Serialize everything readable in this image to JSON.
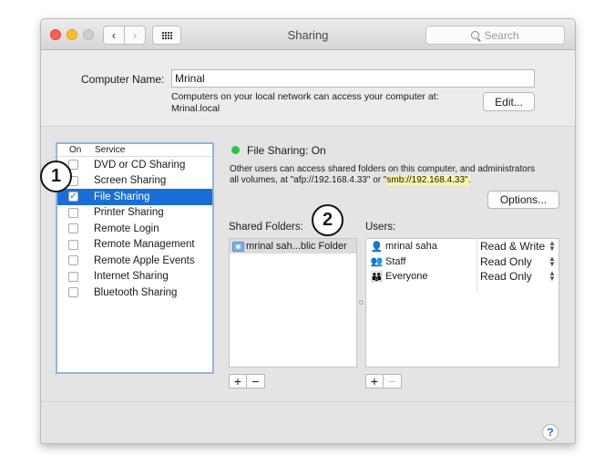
{
  "window": {
    "title": "Sharing",
    "search_placeholder": "Search",
    "back_glyph": "‹",
    "forward_glyph": "›"
  },
  "computer_name": {
    "label": "Computer Name:",
    "value": "Mrinal",
    "info_line1": "Computers on your local network can access your computer at:",
    "info_line2": "Mrinal.local",
    "edit_label": "Edit..."
  },
  "service_list": {
    "header_on": "On",
    "header_service": "Service",
    "items": [
      {
        "label": "DVD or CD Sharing",
        "checked": false,
        "selected": false
      },
      {
        "label": "Screen Sharing",
        "checked": false,
        "selected": false
      },
      {
        "label": "File Sharing",
        "checked": true,
        "selected": true
      },
      {
        "label": "Printer Sharing",
        "checked": false,
        "selected": false
      },
      {
        "label": "Remote Login",
        "checked": false,
        "selected": false
      },
      {
        "label": "Remote Management",
        "checked": false,
        "selected": false
      },
      {
        "label": "Remote Apple Events",
        "checked": false,
        "selected": false
      },
      {
        "label": "Internet Sharing",
        "checked": false,
        "selected": false
      },
      {
        "label": "Bluetooth Sharing",
        "checked": false,
        "selected": false
      }
    ]
  },
  "markers": {
    "one": "1",
    "two": "2"
  },
  "status": {
    "text": "File Sharing: On",
    "color": "#28c840",
    "desc_line1": "Other users can access shared folders on this computer, and administrators",
    "desc_line2_pre": "all volumes, at \"afp://192.168.4.33\" or \"",
    "desc_line2_hl": "smb://192.168.4.33\".",
    "options_label": "Options..."
  },
  "shared_folders": {
    "label": "Shared Folders:",
    "items": [
      "mrinal sah...blic Folder"
    ]
  },
  "users": {
    "label": "Users:",
    "items": [
      {
        "name": "mrinal saha",
        "permission": "Read & Write",
        "icon": "single-user-icon"
      },
      {
        "name": "Staff",
        "permission": "Read Only",
        "icon": "group-icon"
      },
      {
        "name": "Everyone",
        "permission": "Read Only",
        "icon": "everyone-icon"
      }
    ]
  },
  "buttons": {
    "add": "+",
    "remove": "−",
    "help": "?"
  },
  "colors": {
    "selection": "#1a6fd6",
    "list_border": "#92b4e0",
    "highlight": "#fbf6a6"
  }
}
